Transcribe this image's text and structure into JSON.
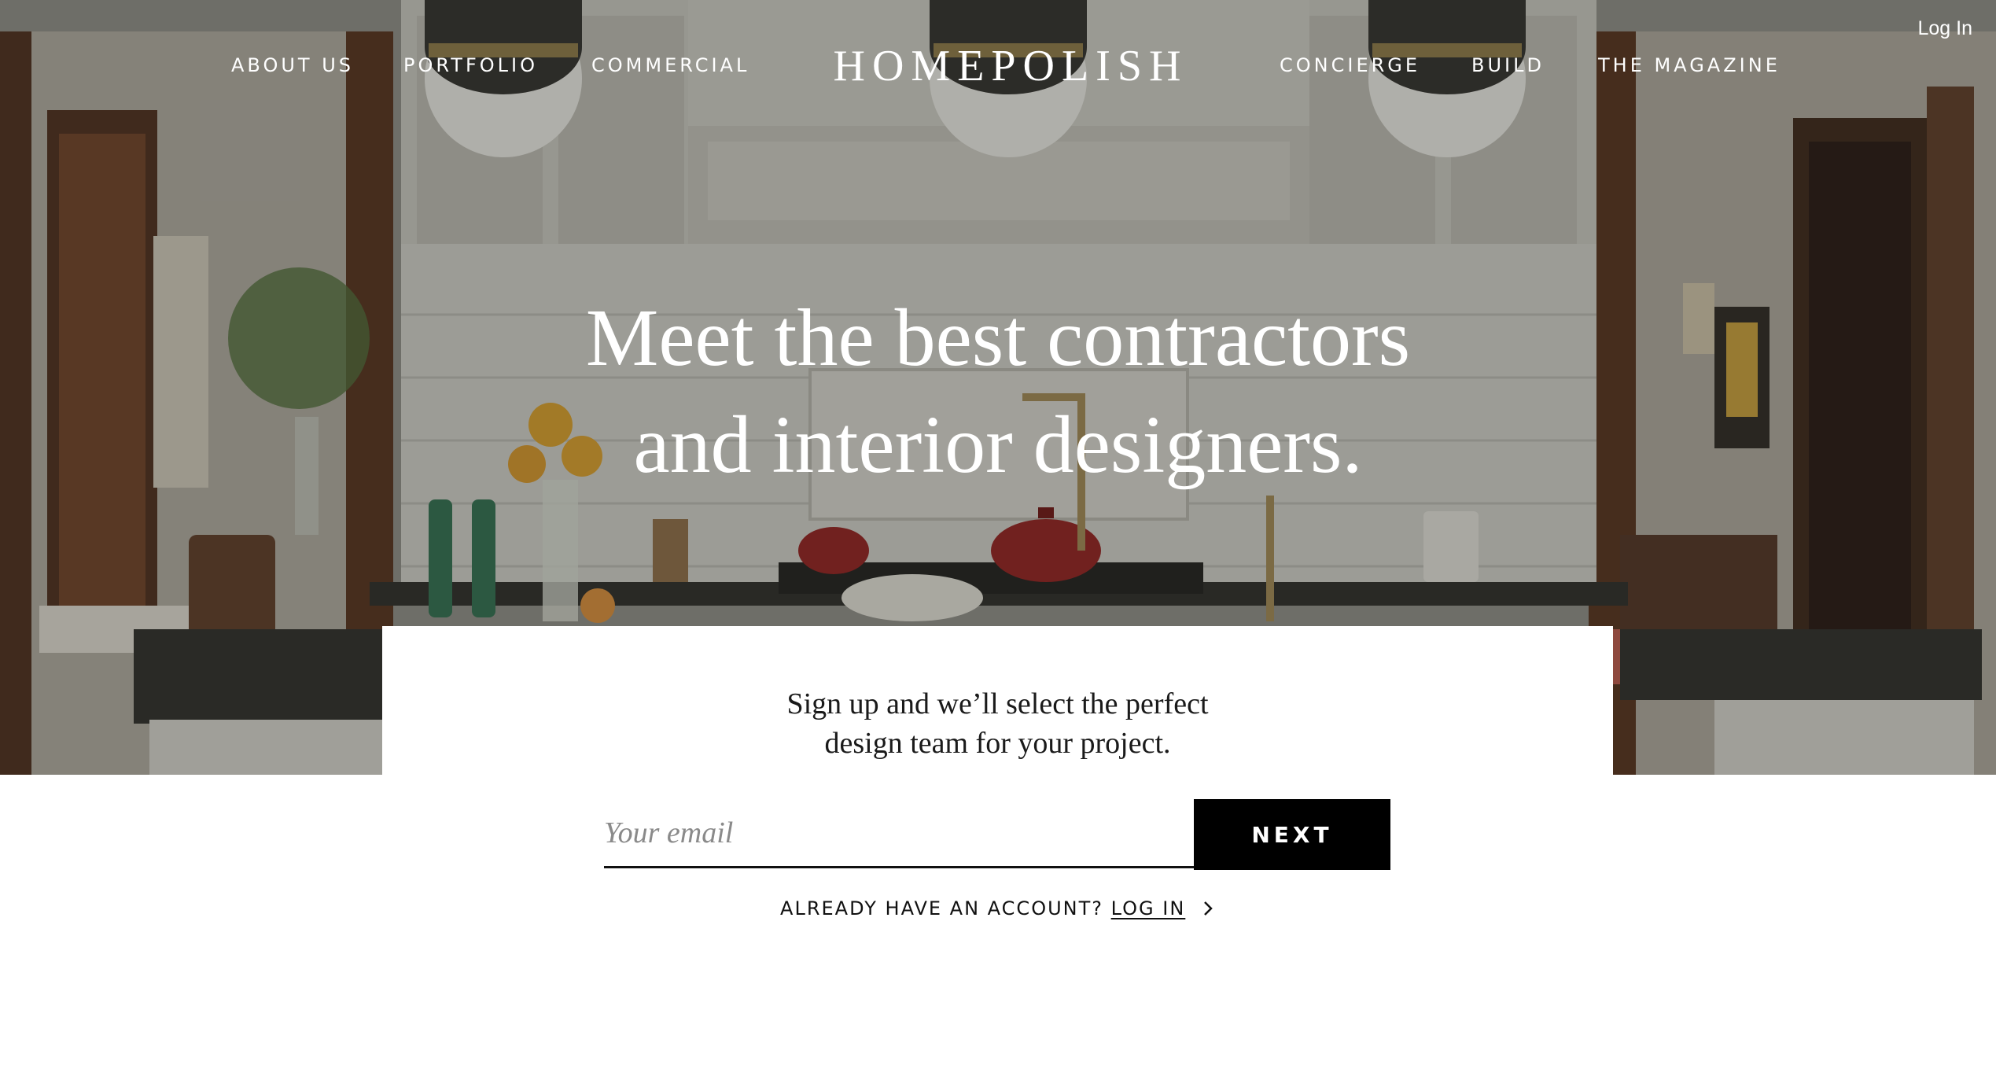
{
  "header": {
    "login_label": "Log In",
    "logo": "HOMEPOLISH",
    "nav_left": [
      "ABOUT US",
      "PORTFOLIO",
      "COMMERCIAL"
    ],
    "nav_right": [
      "CONCIERGE",
      "BUILD",
      "THE MAGAZINE"
    ]
  },
  "hero": {
    "headline_line1": "Meet the best contractors",
    "headline_line2": "and interior designers."
  },
  "signup": {
    "text_line1": "Sign up and we’ll select the perfect",
    "text_line2": "design team for your project.",
    "email_placeholder": "Your email",
    "email_value": "",
    "next_label": "NEXT",
    "account_prompt": "ALREADY HAVE AN ACCOUNT?",
    "account_login_label": "LOG IN"
  },
  "colors": {
    "hero_overlay": "#28261e",
    "button_bg": "#000000",
    "text_on_hero": "#ffffff"
  },
  "icons": {
    "account_arrow": "chevron-right-icon"
  }
}
